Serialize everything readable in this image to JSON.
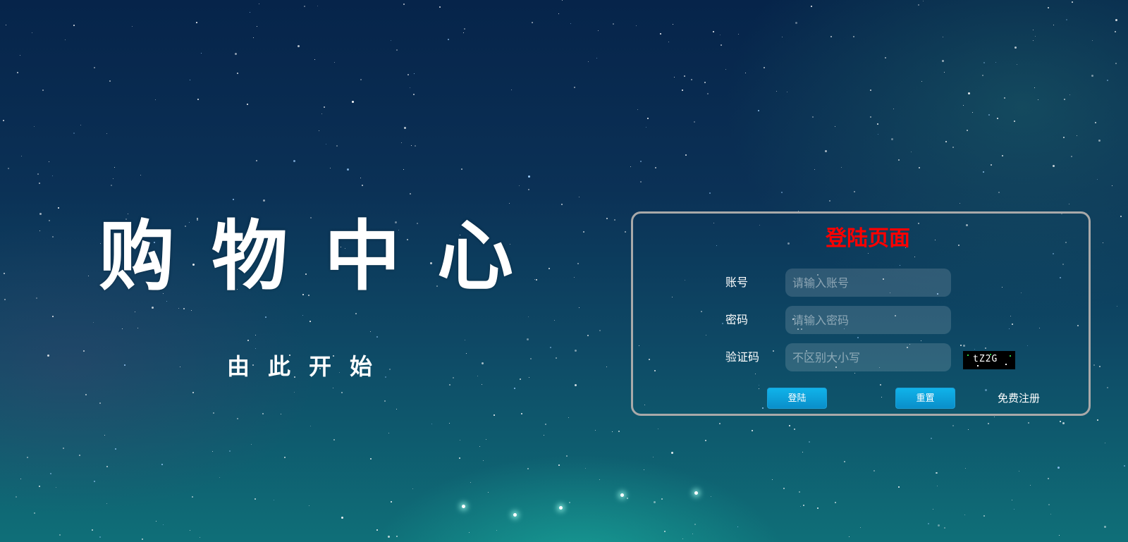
{
  "hero": {
    "title": "购物中心",
    "subtitle": "由此开始"
  },
  "login": {
    "title": "登陆页面",
    "account_label": "账号",
    "account_placeholder": "请输入账号",
    "password_label": "密码",
    "password_placeholder": "请输入密码",
    "captcha_label": "验证码",
    "captcha_placeholder": "不区别大小写",
    "captcha_text": "tZ2G",
    "login_button": "登陆",
    "reset_button": "重置",
    "register_link": "免费注册"
  },
  "colors": {
    "login_title": "#ff0000",
    "button": "#0a9fd8",
    "box_border": "#a9a9a9"
  }
}
